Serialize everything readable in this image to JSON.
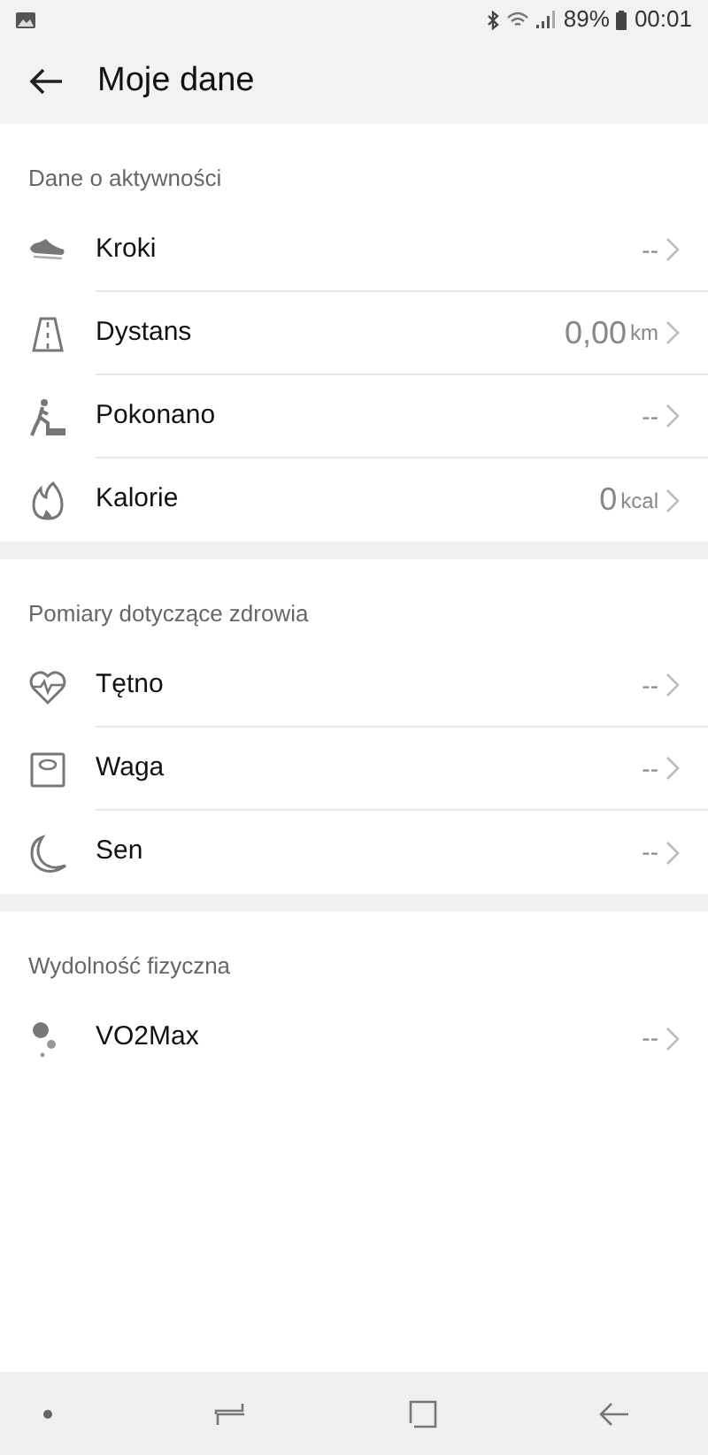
{
  "status_bar": {
    "battery": "89%",
    "time": "00:01"
  },
  "header": {
    "title": "Moje dane"
  },
  "sections": [
    {
      "title": "Dane o aktywności",
      "items": [
        {
          "kind": "steps",
          "label": "Kroki",
          "value": "--"
        },
        {
          "kind": "distance",
          "label": "Dystans",
          "value": "0,00",
          "unit": "km"
        },
        {
          "kind": "climb",
          "label": "Pokonano",
          "value": "--"
        },
        {
          "kind": "calories",
          "label": "Kalorie",
          "value": "0",
          "unit": "kcal"
        }
      ]
    },
    {
      "title": "Pomiary dotyczące zdrowia",
      "items": [
        {
          "kind": "heart",
          "label": "Tętno",
          "value": "--"
        },
        {
          "kind": "weight",
          "label": "Waga",
          "value": "--"
        },
        {
          "kind": "sleep",
          "label": "Sen",
          "value": "--"
        }
      ]
    },
    {
      "title": "Wydolność fizyczna",
      "items": [
        {
          "kind": "vo2",
          "label": "VO2Max",
          "value": "--"
        }
      ]
    }
  ]
}
